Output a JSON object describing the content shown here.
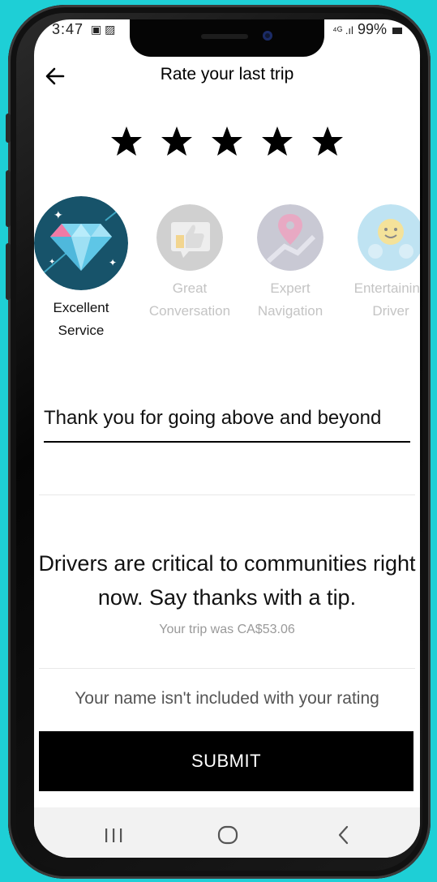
{
  "status_bar": {
    "time": "3:47",
    "battery": "99%"
  },
  "header": {
    "title": "Rate your last trip"
  },
  "rating": {
    "stars_total": 5,
    "stars_selected": 5
  },
  "compliments": [
    {
      "label": "Excellent\nService",
      "icon": "diamond-icon",
      "selected": true
    },
    {
      "label": "Great\nConversation",
      "icon": "thumbs-up-icon",
      "selected": false
    },
    {
      "label": "Expert\nNavigation",
      "icon": "map-pin-icon",
      "selected": false
    },
    {
      "label": "Entertaining\nDriver",
      "icon": "smiley-icon",
      "selected": false
    }
  ],
  "comment": {
    "value": "Thank you for going above and beyond"
  },
  "tip": {
    "message": "Drivers are critical to communities right now. Say thanks with a tip.",
    "trip_cost": "Your trip was CA$53.06"
  },
  "privacy_note": "Your name isn't included with your rating",
  "submit_label": "SUBMIT",
  "colors": {
    "background": "#1ecfd6",
    "submit_bg": "#000000",
    "diamond_circle": "#17536a"
  }
}
